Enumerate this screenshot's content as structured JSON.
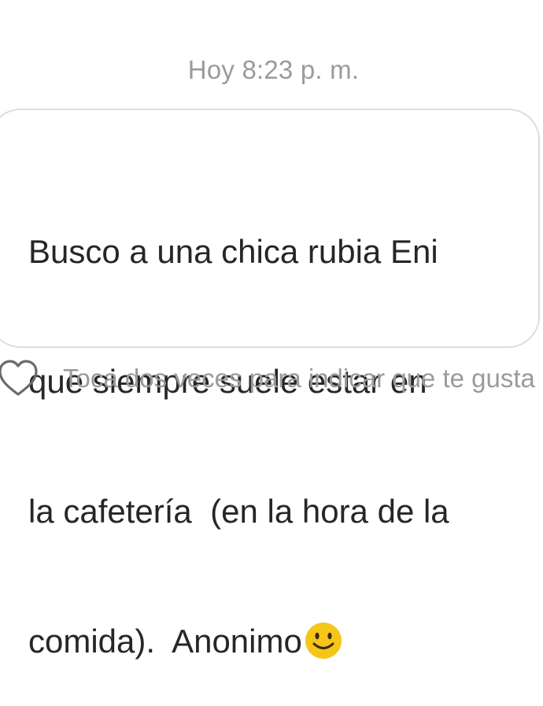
{
  "conversation": {
    "timestamp": "Hoy 8:23 p. m."
  },
  "message": {
    "lines": [
      "Busco a una chica rubia Eni",
      "que siempre suele estar en",
      "la cafetería  (en la hora de la",
      "comida).  Anonimo"
    ],
    "emoji": "smiling-face"
  },
  "reaction": {
    "icon": "heart-outline",
    "hint": "Toca dos veces para indicar que te gusta"
  },
  "colors": {
    "text_primary": "#262626",
    "text_secondary": "#9a9a9a",
    "bubble_border": "#dcdcdc",
    "emoji_face": "#f5c518"
  }
}
